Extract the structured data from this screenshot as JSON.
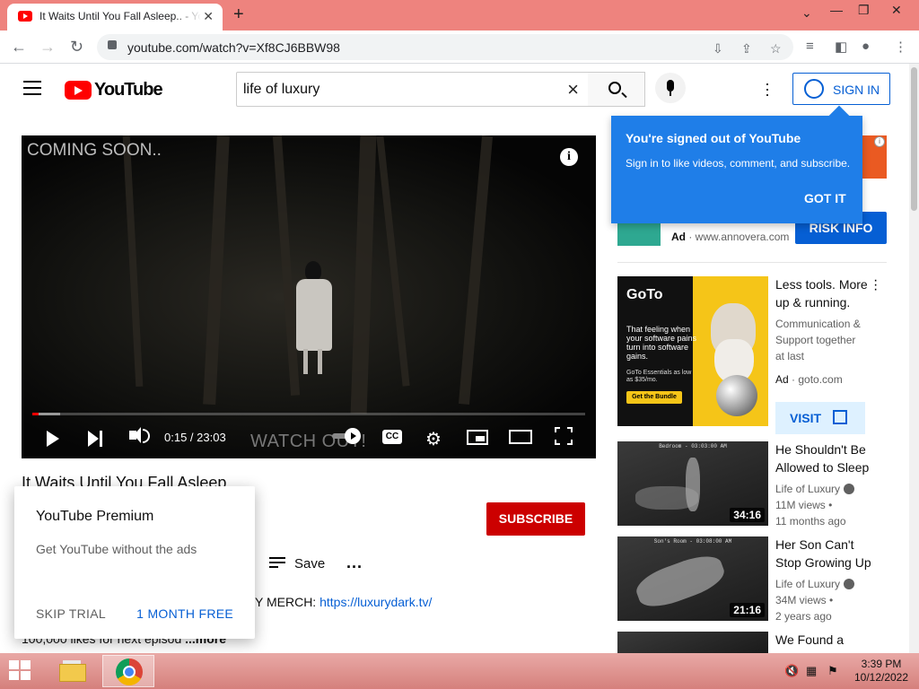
{
  "browser": {
    "tab_title": "It Waits Until You Fall Asleep.. - YouTube",
    "url": "youtube.com/watch?v=Xf8CJ6BBW98",
    "new_tab_symbol": "+",
    "close_tab_symbol": "✕"
  },
  "youtube_header": {
    "logo_text": "YouTube",
    "search_query": "life of luxury",
    "sign_in_label": "SIGN IN"
  },
  "signed_out_popup": {
    "heading": "You're signed out of YouTube",
    "body": "Sign in to like videos, comment, and subscribe.",
    "button": "GOT IT"
  },
  "player": {
    "overlay_text": "COMING SOON..",
    "watermark_text": "WATCH OUT!",
    "time": "0:15 / 23:03",
    "progress_fraction": 0.011,
    "buffer_fraction": 0.05,
    "cc_label": "CC",
    "info_label": "i"
  },
  "video": {
    "title": "It Waits Until You Fall Asleep..",
    "subscribe_label": "SUBSCRIBE",
    "save_label": "Save",
    "more_actions": "...",
    "merch_prefix": "Y MERCH: ",
    "merch_link": "https://luxurydark.tv/",
    "desc_tail": "100,000 likes for next episod",
    "desc_more": "...more"
  },
  "premium_popup": {
    "heading": "YouTube Premium",
    "body": "Get YouTube without the ads",
    "skip_label": "SKIP TRIAL",
    "free_label": "1 MONTH FREE"
  },
  "right_column": {
    "ad1": {
      "ad_label": "Ad",
      "domain": "www.annovera.com",
      "cta": "RISK INFO",
      "info_symbol": "i"
    },
    "ad2": {
      "title": "Less tools. More up & running.",
      "description": "Communication & Support together at last",
      "ad_label": "Ad",
      "domain": "goto.com",
      "cta": "VISIT",
      "thumb_logo": "GoTo",
      "thumb_tagline": "That feeling when your software pains turn into software gains.",
      "thumb_price": "GoTo Essentials as low as $35/mo.",
      "thumb_button": "Get the Bundle"
    },
    "videos": [
      {
        "title": "He Shouldn't Be Allowed to Sleep",
        "channel": "Life of Luxury",
        "views": "11M views",
        "age": "11 months ago",
        "duration": "34:16",
        "thumb_caption": "Bedroom - 03:03:00 AM"
      },
      {
        "title": "Her Son Can't Stop Growing Up",
        "channel": "Life of Luxury",
        "views": "34M views",
        "age": "2 years ago",
        "duration": "21:16",
        "thumb_caption": "Son's Room - 03:08:00 AM"
      },
      {
        "title": "We Found a",
        "channel": "",
        "views": "",
        "age": "",
        "duration": "",
        "thumb_caption": ""
      }
    ]
  },
  "taskbar": {
    "time": "3:39 PM",
    "date": "10/12/2022"
  }
}
